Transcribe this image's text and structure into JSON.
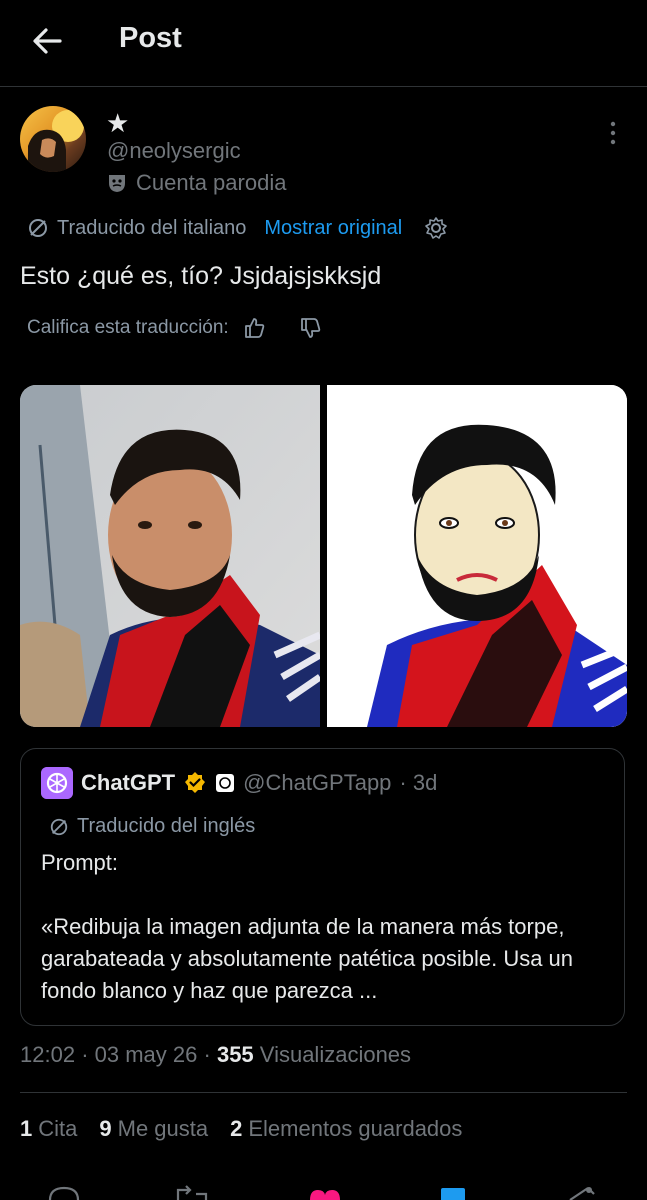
{
  "header": {
    "title": "Post"
  },
  "author": {
    "display_name": "★",
    "handle": "@neolysergic",
    "label": "Cuenta parodia"
  },
  "translation": {
    "note": "Traducido del italiano",
    "show_original": "Mostrar original"
  },
  "post": {
    "text": "Esto ¿qué es, tío? Jsjdajsjskksjd"
  },
  "rating": {
    "label": "Califica esta traducción:"
  },
  "quoted": {
    "name": "ChatGPT",
    "handle": "@ChatGPTapp",
    "time": "· 3d",
    "translation_note": "Traducido del inglés",
    "text": "Prompt:\n\n«Redibuja la imagen adjunta de la manera más torpe, garabateada y absolutamente patética posible. Usa un fondo blanco y haz que parezca ..."
  },
  "meta": {
    "time": "12:02",
    "dot1": "·",
    "date": "03 may 26",
    "dot2": "·",
    "views": "355",
    "views_label": "Visualizaciones"
  },
  "stats": {
    "quotes_count": "1",
    "quotes_label": "Cita",
    "likes_count": "9",
    "likes_label": "Me gusta",
    "saves_count": "2",
    "saves_label": "Elementos guardados"
  },
  "colors": {
    "accent": "#1d9bf0",
    "background": "#000000",
    "muted": "#71767b",
    "verified": "#f5b800",
    "chatgpt": "#ab68ff"
  }
}
